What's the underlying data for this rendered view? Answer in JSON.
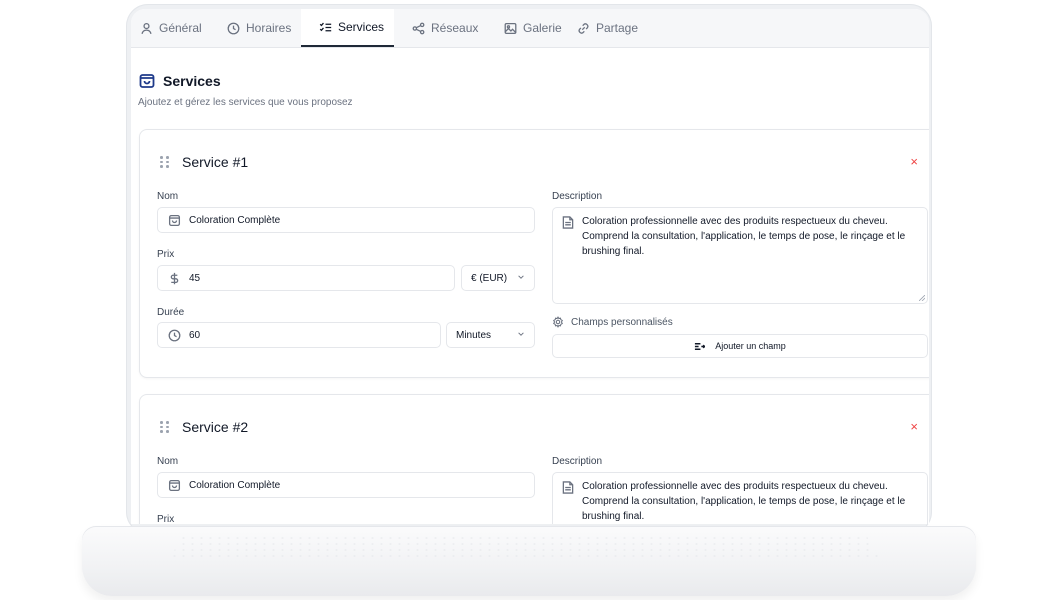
{
  "tabs": [
    {
      "label": "Général",
      "icon": "user-icon"
    },
    {
      "label": "Horaires",
      "icon": "clock-icon"
    },
    {
      "label": "Services",
      "icon": "list-check-icon",
      "active": true
    },
    {
      "label": "Réseaux",
      "icon": "share-nodes-icon"
    },
    {
      "label": "Galerie",
      "icon": "image-icon"
    },
    {
      "label": "Partage",
      "icon": "link-icon"
    }
  ],
  "section": {
    "title": "Services",
    "subtitle": "Ajoutez et gérez les services que vous proposez"
  },
  "labels": {
    "name": "Nom",
    "price": "Prix",
    "duration": "Durée",
    "description": "Description",
    "custom_fields": "Champs personnalisés",
    "add_field": "Ajouter un champ"
  },
  "services": [
    {
      "title": "Service #1",
      "name": "Coloration Complète",
      "price": "45",
      "currency": "€ (EUR)",
      "duration": "60",
      "duration_unit": "Minutes",
      "description": "Coloration professionnelle avec des produits respectueux du cheveu. Comprend la consultation, l'application, le temps de pose, le rinçage et le brushing final."
    },
    {
      "title": "Service #2",
      "name": "Coloration Complète",
      "description": "Coloration professionnelle avec des produits respectueux du cheveu. Comprend la consultation, l'application, le temps de pose, le rinçage et le brushing final."
    }
  ],
  "remove_symbol": "×",
  "colors": {
    "accent": "#1e3a8a",
    "danger": "#ef4444",
    "border": "#e5e7eb"
  }
}
